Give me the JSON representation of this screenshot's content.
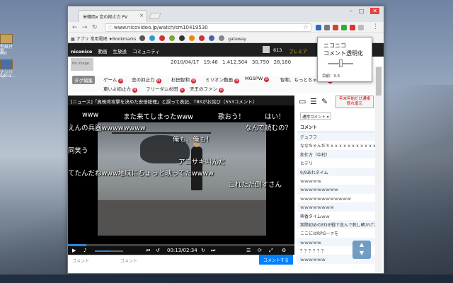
{
  "desktop": {
    "icons": [
      {
        "label": "型紙付置"
      },
      {
        "label": "md"
      },
      {
        "label": "ナンバー"
      },
      {
        "label": "Sjkna..."
      }
    ]
  },
  "browser": {
    "tab_title": "米韓両x 恋の抑止力 PV",
    "url": "www.nicovideo.jp/watch/sm10419530",
    "bookmarks": [
      "アプリ",
      "常用電網",
      "Bookmarks",
      "gateway"
    ],
    "nav": {
      "logo": "niconico",
      "items": [
        "動画",
        "生放送",
        "コミュニティ"
      ],
      "points": "613",
      "premium": "プレミア"
    }
  },
  "info": {
    "noimage": "No image",
    "date": "2010/04/17 19:46",
    "views": "1,412,504",
    "comments": "30,750",
    "mylist": "28,180"
  },
  "tags": {
    "edit": "タグ編集",
    "items": [
      "ゲーム",
      "恋の抑止力",
      "杉田智和",
      "ミリオン動画",
      "MGSPW",
      "智和、もっとちゃんと",
      "東いよ抑止力",
      "フリーダム杉田",
      "天王のファン"
    ]
  },
  "video": {
    "title": "[ニュース]「真珠湾攻撃を決めた安倍総理」と誤って表記、TBSがお詫び（553コメント）",
    "comments": [
      "www",
      "また来てしまったwww",
      "歌おう！",
      "はい！",
      "えんの兵器wwwwwwww",
      "なんで読むの？",
      "同笑う",
      "俺も、俺も！",
      "アニサキ叫んだ",
      "てたんだねwww地味にちょっと映ってたwwww",
      "これただ倒すさん"
    ],
    "time": "00:13/02:34",
    "progress": 0.08,
    "volume": 0.55,
    "comment_placeholder": "コメント",
    "comment_input": "コメント",
    "submit": "コメントする"
  },
  "side": {
    "restore_label": "年末年始だけ通帳隠れ復元",
    "sort": "通常コメント",
    "header": "コメント",
    "rows": [
      "デュフフ",
      "ななちゃんだＸｘｘｘｘｘｘｘｘｘｘｘｘ",
      "和仕方（中村）",
      "ヒデリ",
      "9/9あれタイム",
      "ｗｗｗｗｗ",
      "ｗｗｗｗｗｗｗｗｗ",
      "ｗｗｗｗｗｗｗｗｗｗｗｗ",
      "ｗｗｗｗｗｗｗｗ",
      "興香タイムｗｗ",
      "実際初めのEDIE戦で念んで刺し確かげえ",
      "ここにはRPGーァを",
      "ｗｗｗｗｗ",
      "？？？？？？",
      "ｗｗｗｗｗｗ"
    ]
  },
  "popup": {
    "title_line1": "ニコニコ",
    "title_line2": "コメント透明化",
    "opacity_label": "目前：0.5",
    "opacity": 0.5
  }
}
